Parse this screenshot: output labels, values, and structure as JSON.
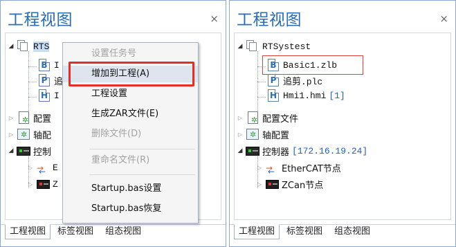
{
  "left_panel": {
    "title": "工程视图",
    "close_glyph": "×",
    "tree": {
      "project_root": "RTS",
      "child_basic_letter": "B",
      "child_basic_text": "I",
      "child_plc_letter": "P",
      "child_plc_text": "追",
      "child_hmi_letter": "H",
      "child_hmi_text": "I",
      "config": "配置",
      "axis_config": "轴配",
      "controller": "控制",
      "ethercat_text": "E",
      "zcan_text": "Z"
    },
    "tabs": [
      "工程视图",
      "标签视图",
      "组态视图"
    ],
    "context_menu": {
      "items": [
        {
          "label": "设置任务号",
          "disabled": true
        },
        {
          "label": "增加到工程(A)",
          "disabled": false,
          "highlighted": true
        },
        {
          "label": "工程设置",
          "disabled": false
        },
        {
          "label": "生成ZAR文件(E)",
          "disabled": false
        },
        {
          "label": "删除文件(D)",
          "disabled": true
        },
        {
          "label": "重命名文件(R)",
          "disabled": true
        },
        {
          "label": "Startup.bas设置",
          "disabled": false
        },
        {
          "label": "Startup.bas恢复",
          "disabled": false
        }
      ]
    }
  },
  "right_panel": {
    "title": "工程视图",
    "close_glyph": "×",
    "tree": {
      "project_root": "RTSystest",
      "files": [
        {
          "letter": "B",
          "name": "Basic1.zlb"
        },
        {
          "letter": "P",
          "name": "追剪.plc"
        },
        {
          "letter": "H",
          "name": "Hmi1.hmi",
          "extra": "[1]"
        }
      ],
      "config": "配置文件",
      "axis_config": "轴配置",
      "controller": "控制器",
      "controller_ip": "[172.16.19.24]",
      "ethercat": "EtherCAT节点",
      "zcan": "ZCan节点"
    },
    "tabs": [
      "工程视图",
      "标签视图",
      "组态视图"
    ]
  },
  "colors": {
    "title_blue": "#2b6cb3",
    "highlight_red": "#e1302a",
    "ip_blue": "#2060c0"
  }
}
